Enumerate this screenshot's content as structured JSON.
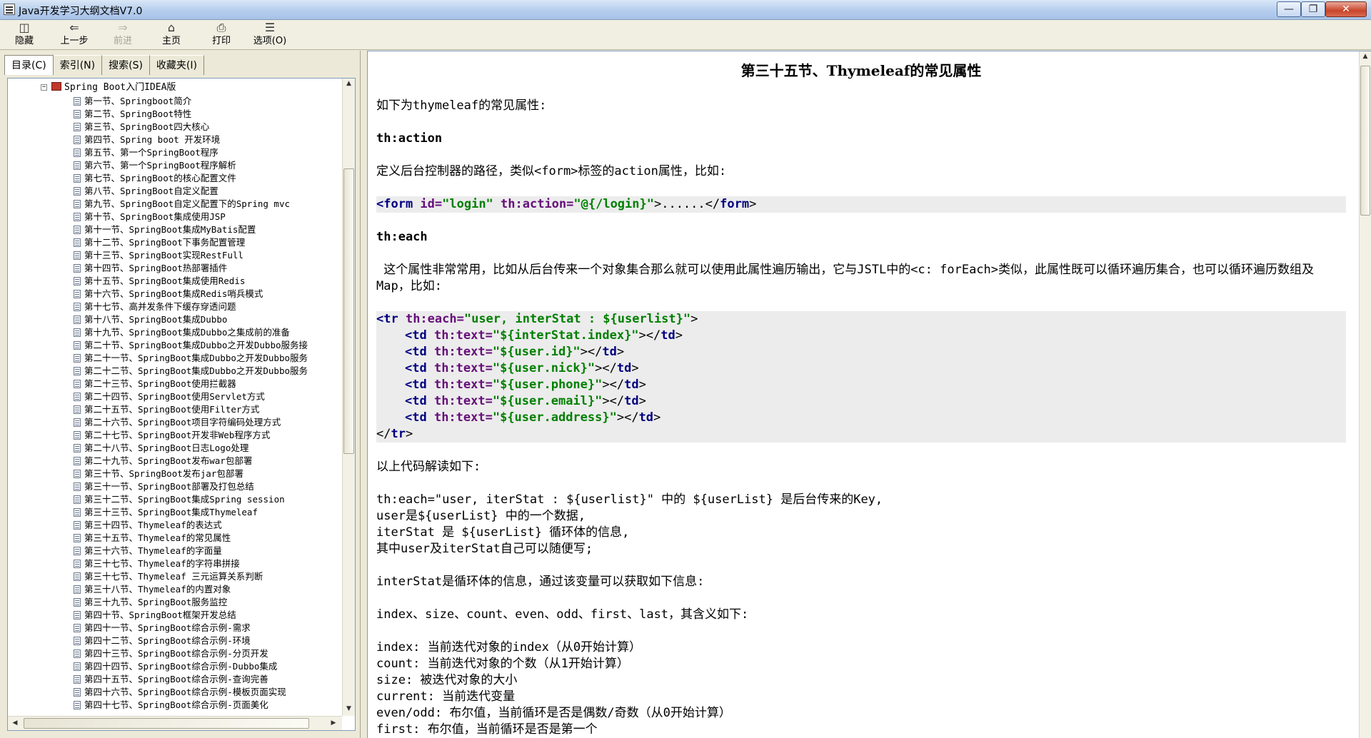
{
  "window": {
    "title": "Java开发学习大纲文档V7.0"
  },
  "toolbar": {
    "hide": "隐藏",
    "back": "上一步",
    "forward": "前进",
    "home": "主页",
    "print": "打印",
    "options": "选项(O)"
  },
  "tabs": [
    "目录(C)",
    "索引(N)",
    "搜索(S)",
    "收藏夹(I)"
  ],
  "tree": {
    "root": "Spring Boot入门IDEA版",
    "items": [
      "第一节、Springboot简介",
      "第二节、SpringBoot特性",
      "第三节、SpringBoot四大核心",
      "第四节、Spring boot 开发环境",
      "第五节、第一个SpringBoot程序",
      "第六节、第一个SpringBoot程序解析",
      "第七节、SpringBoot的核心配置文件",
      "第八节、SpringBoot自定义配置",
      "第九节、SpringBoot自定义配置下的Spring mvc",
      "第十节、SpringBoot集成使用JSP",
      "第十一节、SpringBoot集成MyBatis配置",
      "第十二节、SpringBoot下事务配置管理",
      "第十三节、SpringBoot实现RestFull",
      "第十四节、SpringBoot热部署插件",
      "第十五节、SpringBoot集成使用Redis",
      "第十六节、SpringBoot集成Redis哨兵模式",
      "第十七节、高并发条件下缓存穿透问题",
      "第十八节、SpringBoot集成Dubbo",
      "第十九节、SpringBoot集成Dubbo之集成前的准备",
      "第二十节、SpringBoot集成Dubbo之开发Dubbo服务接",
      "第二十一节、SpringBoot集成Dubbo之开发Dubbo服务",
      "第二十二节、SpringBoot集成Dubbo之开发Dubbo服务",
      "第二十三节、SpringBoot使用拦截器",
      "第二十四节、SpringBoot使用Servlet方式",
      "第二十五节、SpringBoot使用Filter方式",
      "第二十六节、SpringBoot项目字符编码处理方式",
      "第二十七节、SpringBoot开发非Web程序方式",
      "第二十八节、SpringBoot日志Logo处理",
      "第二十九节、SpringBoot发布war包部署",
      "第三十节、SpringBoot发布jar包部署",
      "第三十一节、SpringBoot部署及打包总结",
      "第三十二节、SpringBoot集成Spring session",
      "第三十三节、SpringBoot集成Thymeleaf",
      "第三十四节、Thymeleaf的表达式",
      "第三十五节、Thymeleaf的常见属性",
      "第三十六节、Thymeleaf的字面量",
      "第三十七节、Thymeleaf的字符串拼接",
      "第三十七节、Thymeleaf 三元运算关系判断",
      "第三十八节、Thymeleaf的内置对象",
      "第三十九节、SpringBoot服务监控",
      "第四十节、SpringBoot框架开发总结",
      "第四十一节、SpringBoot综合示例-需求",
      "第四十二节、SpringBoot综合示例-环境",
      "第四十三节、SpringBoot综合示例-分页开发",
      "第四十四节、SpringBoot综合示例-Dubbo集成",
      "第四十五节、SpringBoot综合示例-查询完善",
      "第四十六节、SpringBoot综合示例-模板页面实现",
      "第四十七节、SpringBoot综合示例-页面美化"
    ]
  },
  "article": {
    "title": "第三十五节、Thymeleaf的常见属性",
    "intro": "如下为thymeleaf的常见属性:",
    "action_heading": "th:action",
    "action_desc": "定义后台控制器的路径，类似<form>标签的action属性，比如:",
    "each_heading": "th:each",
    "each_desc": " 这个属性非常常用，比如从后台传来一个对象集合那么就可以使用此属性遍历输出，它与JSTL中的<c: forEach>类似，此属性既可以循环遍历集合，也可以循环遍历数组及Map，比如:",
    "explain_heading": "以上代码解读如下:",
    "explain_lines": [
      "th:each=\"user, iterStat : ${userlist}\" 中的 ${userList} 是后台传来的Key,",
      "user是${userList} 中的一个数据,",
      "iterStat 是 ${userList} 循环体的信息,",
      "其中user及iterStat自己可以随便写;"
    ],
    "interstat_desc": "interStat是循环体的信息，通过该变量可以获取如下信息:",
    "props_list": "index、size、count、even、odd、first、last，其含义如下:",
    "meaning_lines": [
      "index: 当前迭代对象的index（从0开始计算）",
      "count: 当前迭代对象的个数（从1开始计算）",
      "size: 被迭代对象的大小",
      "current: 当前迭代变量",
      "even/odd: 布尔值，当前循环是否是偶数/奇数（从0开始计算）",
      "first: 布尔值，当前循环是否是第一个"
    ]
  },
  "code_action": {
    "open_tag": "<form",
    "attr_id": " id=",
    "val_id": "\"login\"",
    "attr_action": " th:action=",
    "val_action": "\"@{/login}\"",
    "mid": ">......</",
    "close_tag": "form",
    "end": ">"
  },
  "code_each": {
    "tr_open": "<tr",
    "tr_attr": " th:each=",
    "tr_val": "\"user, interStat : ${userlist}\"",
    "tr_end": ">",
    "rows": [
      "\"${interStat.index}\"",
      "\"${user.id}\"",
      "\"${user.nick}\"",
      "\"${user.phone}\"",
      "\"${user.email}\"",
      "\"${user.address}\""
    ],
    "td_open": "<td",
    "td_attr": " th:text=",
    "td_close_a": "></",
    "td_close_b": "td",
    "td_close_c": ">",
    "tr_close_a": "</",
    "tr_close_b": "tr",
    "tr_close_c": ">"
  },
  "colors": {
    "code_tag": "#000080",
    "code_attr": "#660e7a",
    "code_value": "#008000",
    "code_bg": "#ececec"
  }
}
